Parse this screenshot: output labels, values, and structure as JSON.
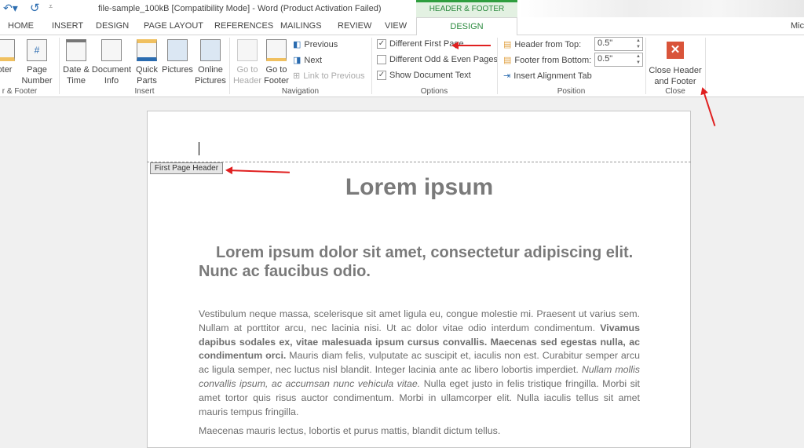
{
  "title_bar": {
    "title": "file-sample_100kB [Compatibility Mode] - Word (Product Activation Failed)",
    "undo_icon": "undo-icon",
    "redo_icon": "redo-icon",
    "qat_icon": "customize-qat-icon",
    "account": "Mic"
  },
  "tabs": [
    "HOME",
    "INSERT",
    "DESIGN",
    "PAGE LAYOUT",
    "REFERENCES",
    "MAILINGS",
    "REVIEW",
    "VIEW"
  ],
  "contextual": {
    "group": "HEADER & FOOTER TOOLS",
    "tab": "DESIGN",
    "color": "#2b8a3e"
  },
  "ribbon": {
    "hf_group": {
      "label": "r & Footer",
      "footer": "oter",
      "page_number": "Page Number"
    },
    "insert": {
      "label": "Insert",
      "items": [
        "Date & Time",
        "Document Info",
        "Quick Parts",
        "Pictures",
        "Online Pictures"
      ]
    },
    "navigation": {
      "label": "Navigation",
      "go_header": "Go to Header",
      "go_footer": "Go to Footer",
      "previous": "Previous",
      "next": "Next",
      "link_prev": "Link to Previous"
    },
    "options": {
      "label": "Options",
      "items": [
        {
          "label": "Different First Page",
          "checked": true
        },
        {
          "label": "Different Odd & Even Pages",
          "checked": false
        },
        {
          "label": "Show Document Text",
          "checked": true
        }
      ]
    },
    "position": {
      "label": "Position",
      "header_top": "Header from Top:",
      "header_top_value": "0.5\"",
      "footer_bottom": "Footer from Bottom:",
      "footer_bottom_value": "0.5\"",
      "align_tab": "Insert Alignment Tab"
    },
    "close": {
      "label": "Close",
      "button": "Close Header and Footer"
    }
  },
  "document": {
    "header_tag": "First Page Header",
    "title": "Lorem ipsum",
    "subtitle": "Lorem ipsum dolor sit amet, consectetur adipiscing elit. Nunc ac faucibus odio.",
    "p1": [
      "Vestibulum neque massa, scelerisque sit amet ligula eu, congue molestie mi. Praesent ut varius sem. Nullam at porttitor arcu, nec lacinia nisi. Ut ac dolor vitae odio interdum condimentum. ",
      "Vivamus dapibus sodales ex, vitae malesuada ipsum cursus convallis. Maecenas sed egestas nulla, ac condimentum orci.",
      " Mauris diam felis, vulputate ac suscipit et, iaculis non est. Curabitur semper arcu ac ligula semper, nec luctus nisl blandit. Integer lacinia ante ac libero lobortis imperdiet. ",
      "Nullam mollis convallis ipsum, ac accumsan nunc vehicula vitae.",
      " Nulla eget justo in felis tristique fringilla. Morbi sit amet tortor quis risus auctor condimentum. Morbi in ullamcorper elit. Nulla iaculis tellus sit amet mauris tempus fringilla."
    ],
    "p2": "Maecenas mauris lectus, lobortis et purus mattis, blandit dictum tellus."
  },
  "annotation_color": "#e02020"
}
